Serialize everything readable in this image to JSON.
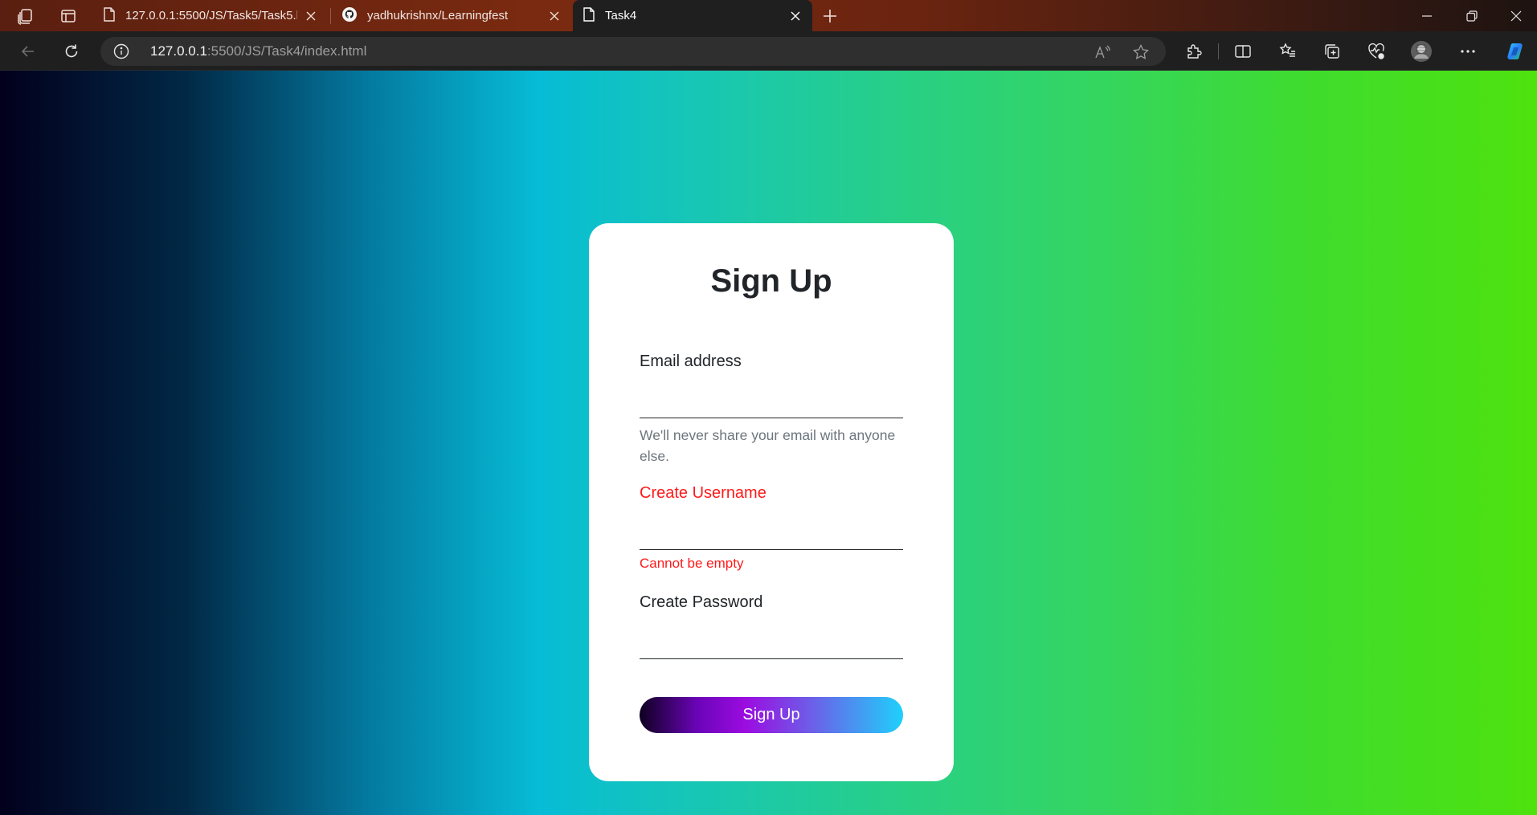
{
  "browser": {
    "tabs": [
      {
        "title": "127.0.0.1:5500/JS/Task5/Task5.html",
        "icon": "file-icon",
        "active": false
      },
      {
        "title": "yadhukrishnx/Learningfest",
        "icon": "github-icon",
        "active": false
      },
      {
        "title": "Task4",
        "icon": "file-icon",
        "active": true
      }
    ],
    "address": {
      "host": "127.0.0.1",
      "rest": ":5500/JS/Task4/index.html"
    },
    "theme_colors": {
      "tabstrip": "#6a2410",
      "toolbar": "#1f1f1f",
      "omnibox": "#2f2f2f"
    }
  },
  "page": {
    "title": "Sign Up",
    "email": {
      "label": "Email address",
      "value": "",
      "help": "We'll never share your email with anyone else."
    },
    "username": {
      "label": "Create Username",
      "value": "",
      "error": "Cannot be empty"
    },
    "password": {
      "label": "Create Password",
      "value": ""
    },
    "submit_label": "Sign Up",
    "colors": {
      "error": "#ff1a1a",
      "text": "#212529",
      "muted": "#6c757d",
      "bg_gradient": [
        "#02001c",
        "#06bcd6",
        "#4ee20d"
      ],
      "button_gradient": [
        "#0e0020",
        "#9b0ce0",
        "#1fd0fb"
      ]
    }
  }
}
